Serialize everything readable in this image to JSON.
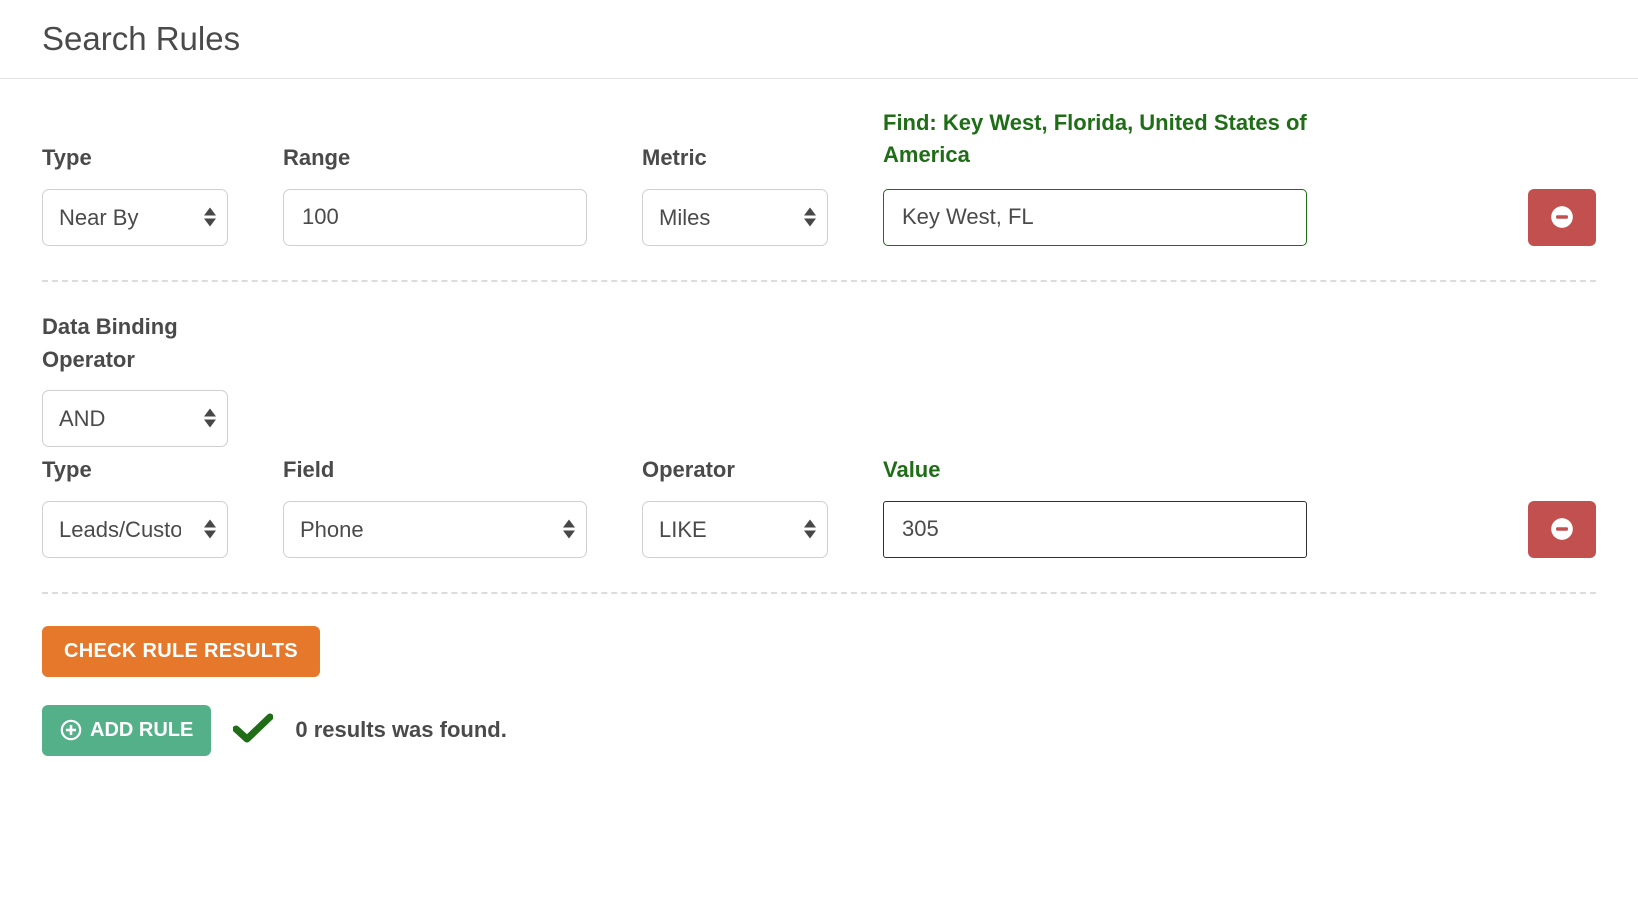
{
  "title": "Search Rules",
  "rule1": {
    "type_label": "Type",
    "type_value": "Near By",
    "range_label": "Range",
    "range_value": "100",
    "metric_label": "Metric",
    "metric_value": "Miles",
    "find_label": "Find: Key West, Florida, United States of America",
    "find_value": "Key West, FL"
  },
  "binding": {
    "label": "Data Binding Operator",
    "value": "AND"
  },
  "rule2": {
    "type_label": "Type",
    "type_value": "Leads/Custom",
    "field_label": "Field",
    "field_value": "Phone",
    "operator_label": "Operator",
    "operator_value": "LIKE",
    "value_label": "Value",
    "value_value": "305"
  },
  "actions": {
    "check_label": "CHECK RULE RESULTS",
    "add_rule_label": "ADD RULE",
    "results_text": "0 results was found."
  }
}
